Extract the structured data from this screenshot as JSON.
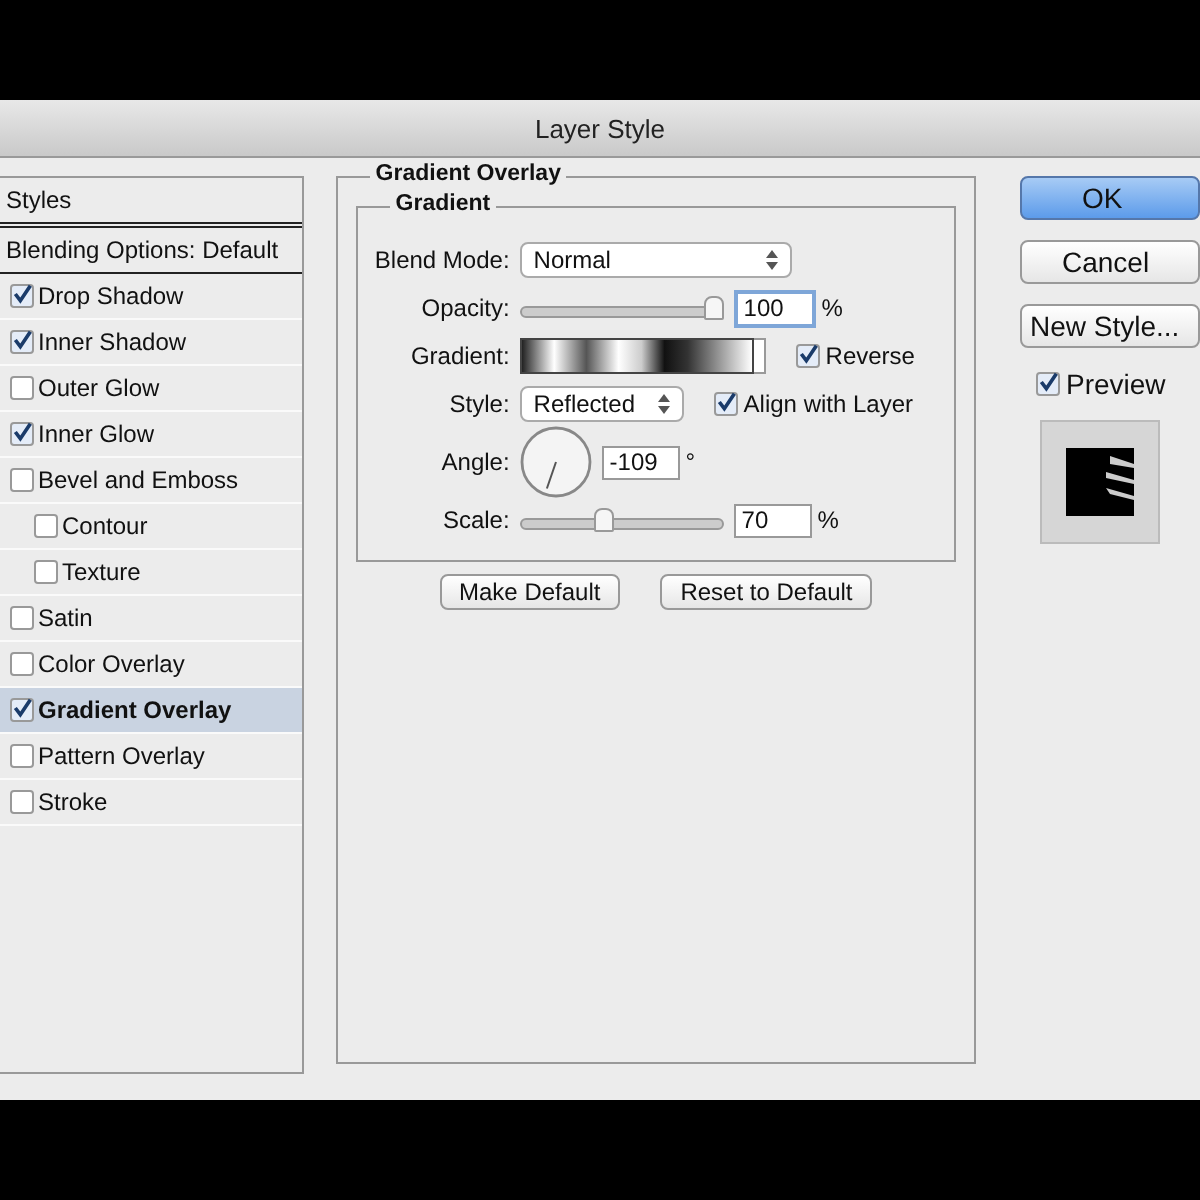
{
  "window": {
    "title": "Layer Style"
  },
  "styles_panel": {
    "header": "Styles",
    "blending_options": {
      "label": "Blending Options: Default",
      "selected": false
    },
    "items": [
      {
        "label": "Drop Shadow",
        "checked": true,
        "selected": false
      },
      {
        "label": "Inner Shadow",
        "checked": true,
        "selected": false
      },
      {
        "label": "Outer Glow",
        "checked": false,
        "selected": false
      },
      {
        "label": "Inner Glow",
        "checked": true,
        "selected": false
      },
      {
        "label": "Bevel and Emboss",
        "checked": false,
        "selected": false,
        "children": [
          {
            "label": "Contour",
            "checked": false,
            "selected": false
          },
          {
            "label": "Texture",
            "checked": false,
            "selected": false
          }
        ]
      },
      {
        "label": "Satin",
        "checked": false,
        "selected": false
      },
      {
        "label": "Color Overlay",
        "checked": false,
        "selected": false
      },
      {
        "label": "Gradient Overlay",
        "checked": true,
        "selected": true
      },
      {
        "label": "Pattern Overlay",
        "checked": false,
        "selected": false
      },
      {
        "label": "Stroke",
        "checked": false,
        "selected": false
      }
    ]
  },
  "gradient_overlay": {
    "title": "Gradient Overlay",
    "group_title": "Gradient",
    "blend_mode": {
      "label": "Blend Mode:",
      "value": "Normal"
    },
    "opacity": {
      "label": "Opacity:",
      "level": 1.0,
      "value": "100",
      "unit": "%"
    },
    "gradient": {
      "label": "Gradient:",
      "reverse": {
        "label": "Reverse",
        "checked": true
      }
    },
    "style": {
      "label": "Style:",
      "value": "Reflected",
      "align_with_layer": {
        "label": "Align with Layer",
        "checked": true
      }
    },
    "angle": {
      "label": "Angle:",
      "value": "-109",
      "unit": "°"
    },
    "scale": {
      "label": "Scale:",
      "level": 0.4,
      "value": "70",
      "unit": "%"
    },
    "buttons": [
      "Make Default",
      "Reset to Default"
    ]
  },
  "actions": {
    "buttons": [
      {
        "label": "OK",
        "kind": "default"
      },
      {
        "label": "Cancel",
        "kind": "normal"
      },
      {
        "label": "New Style...",
        "kind": "normal"
      }
    ],
    "preview": {
      "label": "Preview",
      "checked": true
    }
  }
}
